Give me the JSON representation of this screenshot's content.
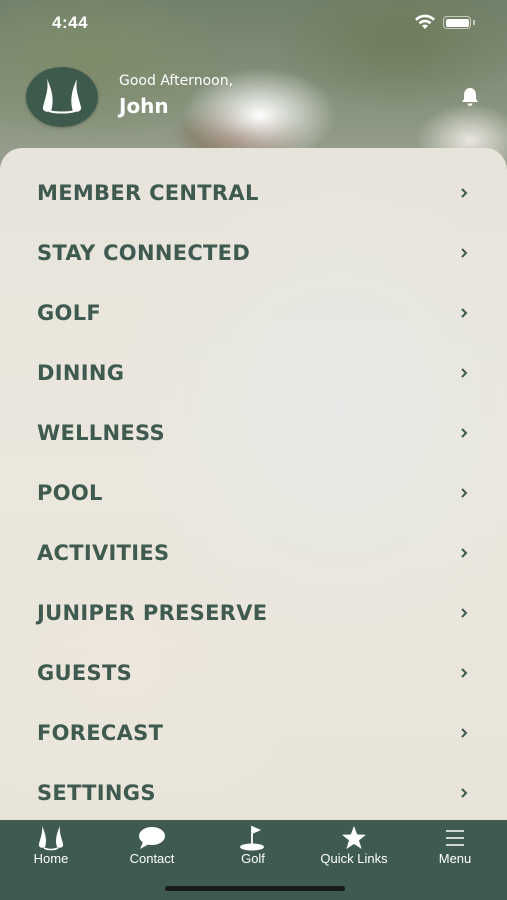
{
  "status_bar": {
    "time": "4:44"
  },
  "header": {
    "greeting": "Good Afternoon,",
    "username": "John",
    "notification_icon": "bell-icon"
  },
  "menu": {
    "items": [
      {
        "label": "MEMBER CENTRAL"
      },
      {
        "label": "STAY CONNECTED"
      },
      {
        "label": "GOLF"
      },
      {
        "label": "DINING"
      },
      {
        "label": "WELLNESS"
      },
      {
        "label": "POOL"
      },
      {
        "label": "ACTIVITIES"
      },
      {
        "label": "JUNIPER PRESERVE"
      },
      {
        "label": "GUESTS"
      },
      {
        "label": "FORECAST"
      },
      {
        "label": "SETTINGS"
      }
    ]
  },
  "tabbar": {
    "tabs": [
      {
        "label": "Home",
        "icon": "logo-icon"
      },
      {
        "label": "Contact",
        "icon": "chat-bubble-icon"
      },
      {
        "label": "Golf",
        "icon": "golf-flag-icon"
      },
      {
        "label": "Quick Links",
        "icon": "star-icon"
      },
      {
        "label": "Menu",
        "icon": "hamburger-menu-icon"
      }
    ]
  },
  "colors": {
    "brand_green": "#3f5a4e",
    "menu_text": "#3f5a4f",
    "panel_bg": "#e8e4da"
  }
}
